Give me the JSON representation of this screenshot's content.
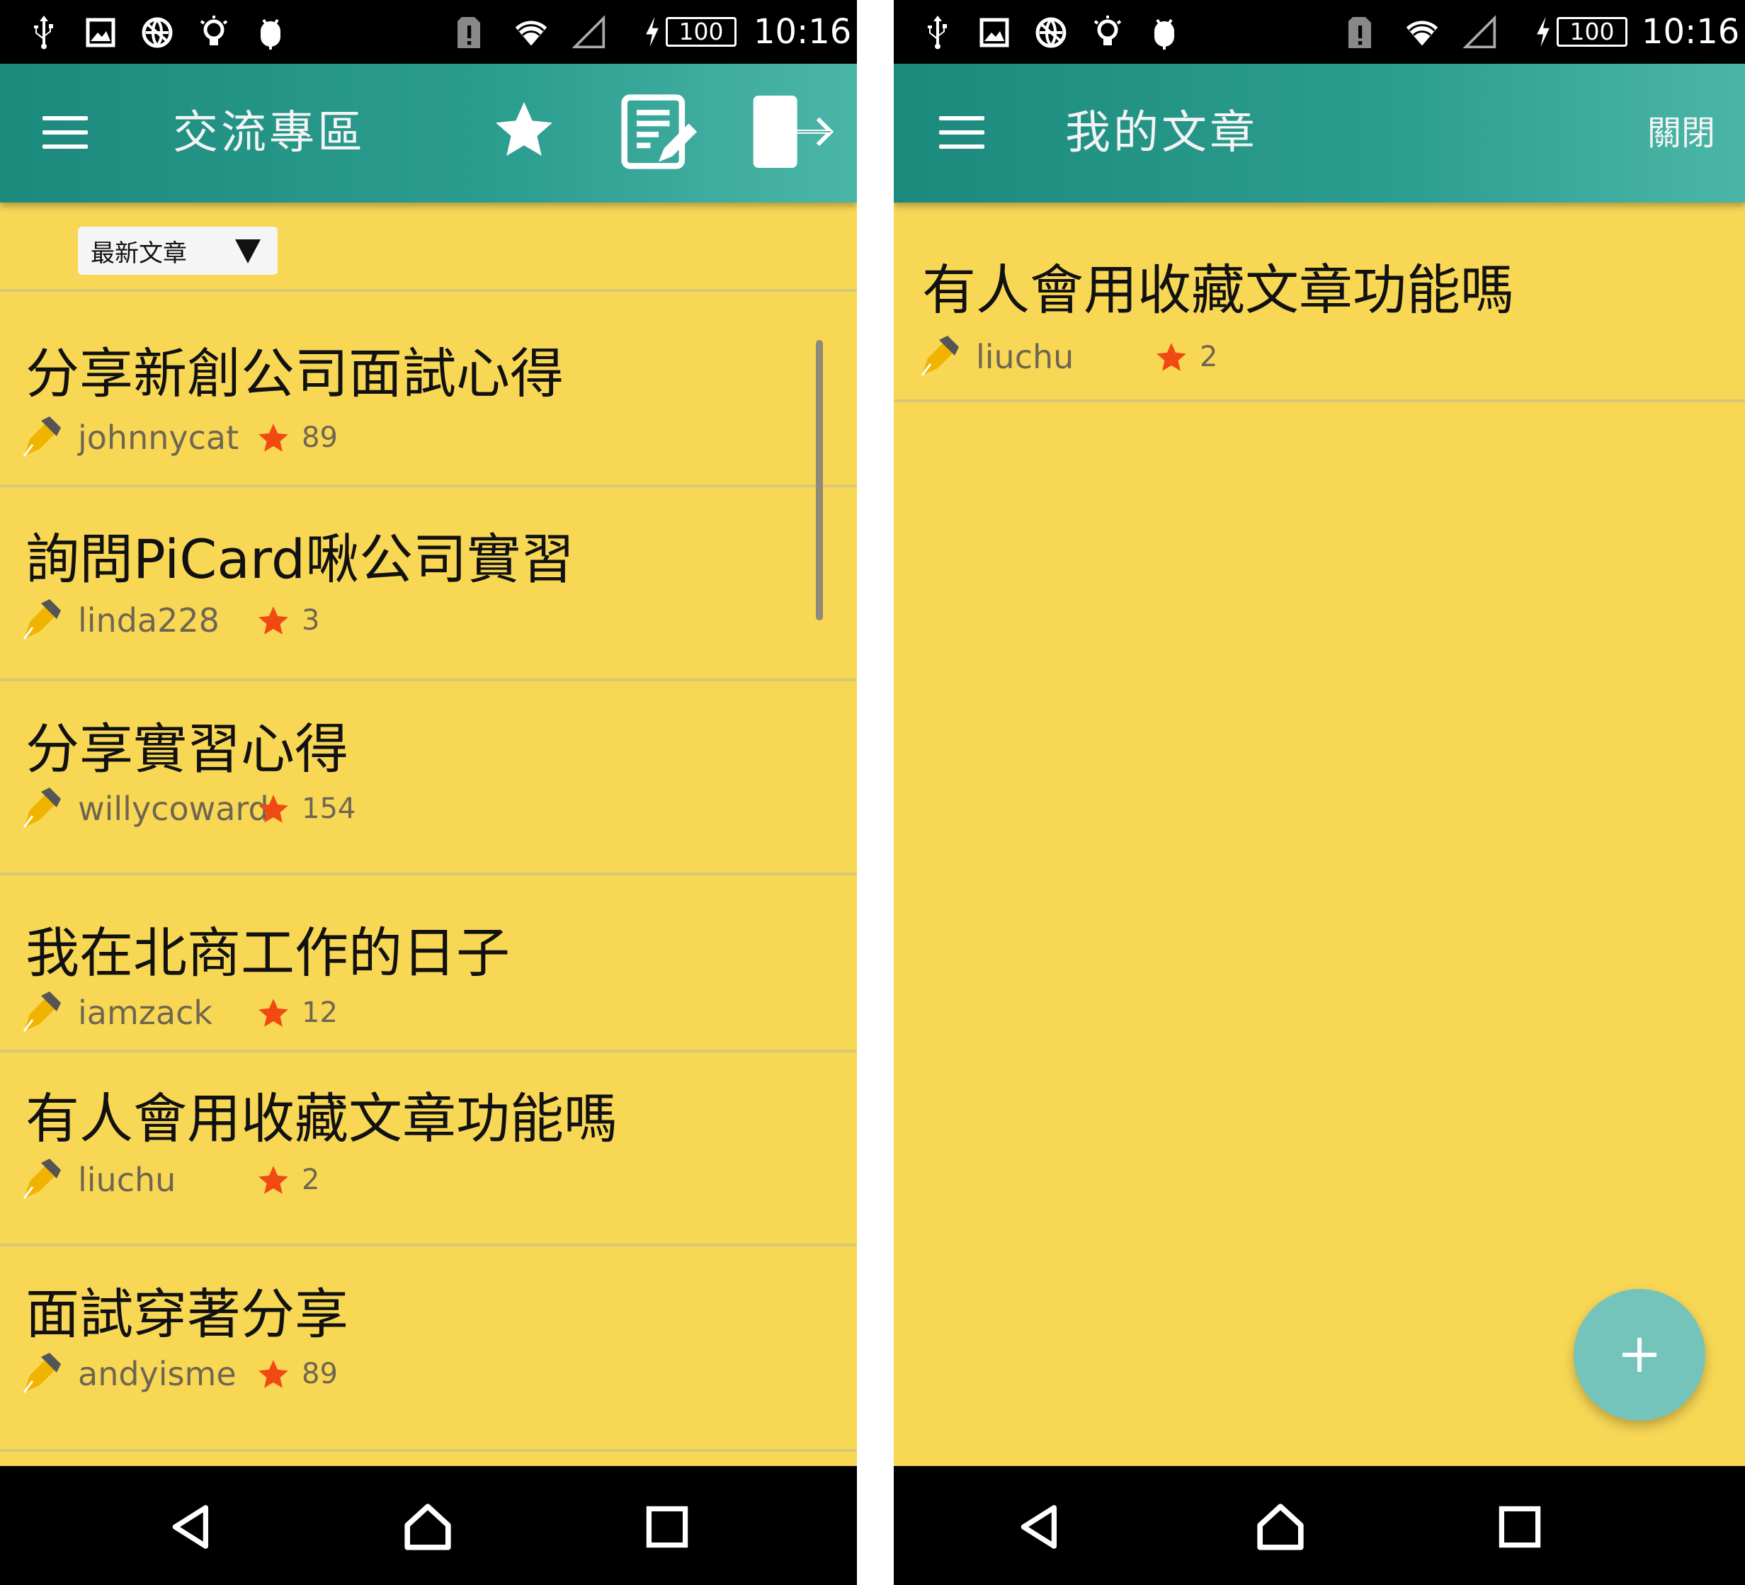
{
  "status_bar": {
    "battery": "100",
    "time": "10:16"
  },
  "left": {
    "app_bar": {
      "title": "交流專區"
    },
    "sort": {
      "selected": "最新文章"
    },
    "posts": [
      {
        "title": "分享新創公司面試心得",
        "author": "johnnycat",
        "stars": "89"
      },
      {
        "title": "詢問PiCard啾公司實習",
        "author": "linda228",
        "stars": "3"
      },
      {
        "title": "分享實習心得",
        "author": "willycoward",
        "stars": "154"
      },
      {
        "title": "我在北商工作的日子",
        "author": "iamzack",
        "stars": "12"
      },
      {
        "title": "有人會用收藏文章功能嗎",
        "author": "liuchu",
        "stars": "2"
      },
      {
        "title": "面試穿著分享",
        "author": "andyisme",
        "stars": "89"
      }
    ]
  },
  "right": {
    "app_bar": {
      "title": "我的文章",
      "close_label": "關閉"
    },
    "posts": [
      {
        "title": "有人會用收藏文章功能嗎",
        "author": "liuchu",
        "stars": "2"
      }
    ]
  },
  "colors": {
    "background": "#f8d755",
    "app_bar": "#2c9e90",
    "star": "#f04a12",
    "fab": "#75c4bc"
  },
  "icons": {
    "status": [
      "usb-icon",
      "image-icon",
      "no-network-icon",
      "lightbulb-icon",
      "android-icon",
      "sim-alert-icon",
      "wifi-icon",
      "signal-icon",
      "charging-icon"
    ],
    "left_actions": [
      "star-icon",
      "edit-note-icon",
      "logout-icon"
    ],
    "meta": [
      "pen-icon",
      "star-icon"
    ],
    "nav": [
      "back-icon",
      "home-icon",
      "recents-icon"
    ],
    "fab": "plus-icon"
  }
}
